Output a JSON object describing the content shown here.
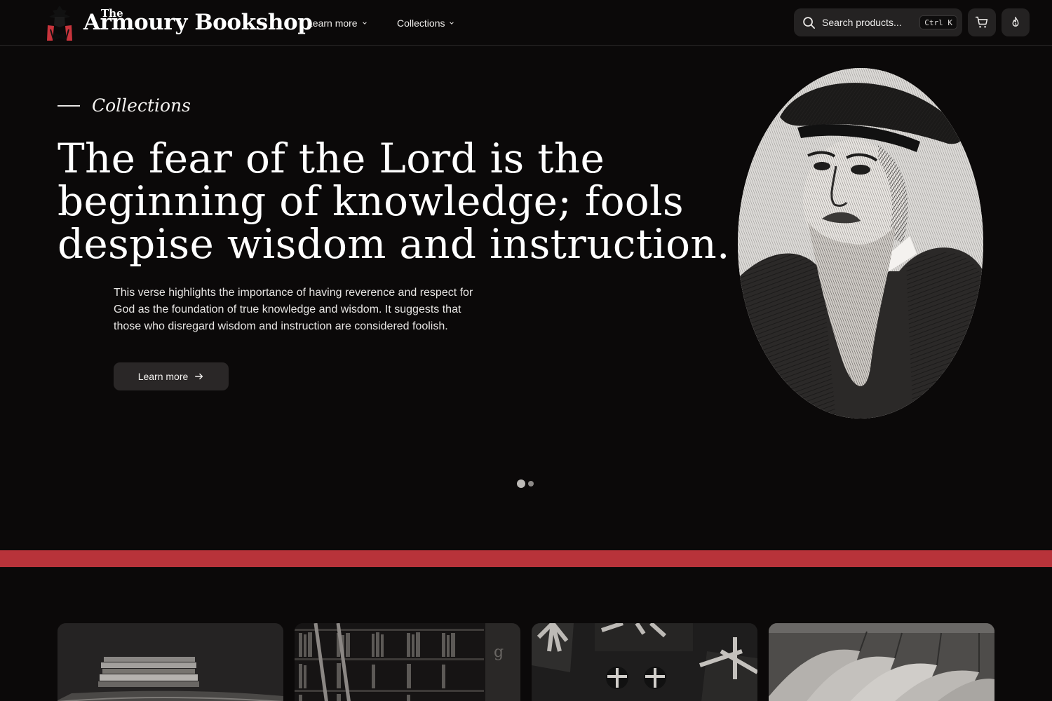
{
  "header": {
    "logo_the": "The",
    "logo_name": "Armoury Bookshop",
    "nav": {
      "learn_more": "Learn more",
      "collections": "Collections"
    },
    "search": {
      "placeholder": "Search products...",
      "shortcut": "Ctrl K"
    },
    "icons": [
      "cart-icon",
      "flame-icon",
      "search-icon",
      "chevron-down-icon"
    ]
  },
  "hero": {
    "eyebrow": "Collections",
    "title": "The fear of the Lord is the beginning of knowledge; fools despise wisdom and instruction.",
    "description": "This verse highlights the importance of having reverence and respect for God as the foundation of true knowledge and wisdom. It suggests that those who disregard wisdom and instruction are considered foolish.",
    "button": "Learn more",
    "carousel": {
      "slides": 2,
      "active": 1
    }
  },
  "colors": {
    "background": "#0b0909",
    "accent_red": "#b8333a",
    "surface": "#242222"
  }
}
